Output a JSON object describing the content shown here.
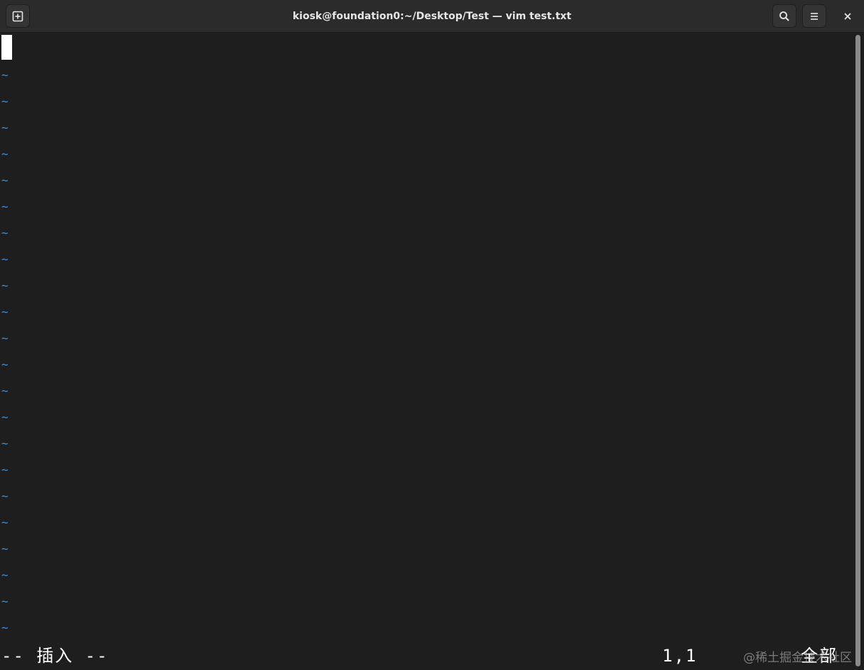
{
  "window": {
    "title": "kiosk@foundation0:~/Desktop/Test — vim test.txt"
  },
  "icons": {
    "new_tab": "new-tab-icon",
    "search": "search-icon",
    "menu": "hamburger-menu-icon",
    "close": "close-icon"
  },
  "colors": {
    "background": "#1e1e1e",
    "titlebar": "#2b2b2b",
    "tilde": "#3d8fd6",
    "text": "#ffffff"
  },
  "editor": {
    "empty_line_marker": "~",
    "empty_lines": [
      "~",
      "~",
      "~",
      "~",
      "~",
      "~",
      "~",
      "~",
      "~",
      "~",
      "~",
      "~",
      "~",
      "~",
      "~",
      "~",
      "~",
      "~",
      "~",
      "~",
      "~",
      "~"
    ]
  },
  "statusline": {
    "mode": "-- 插入 --",
    "position": "1,1",
    "scroll": "全部"
  },
  "watermark": "@稀土掘金技术社区"
}
